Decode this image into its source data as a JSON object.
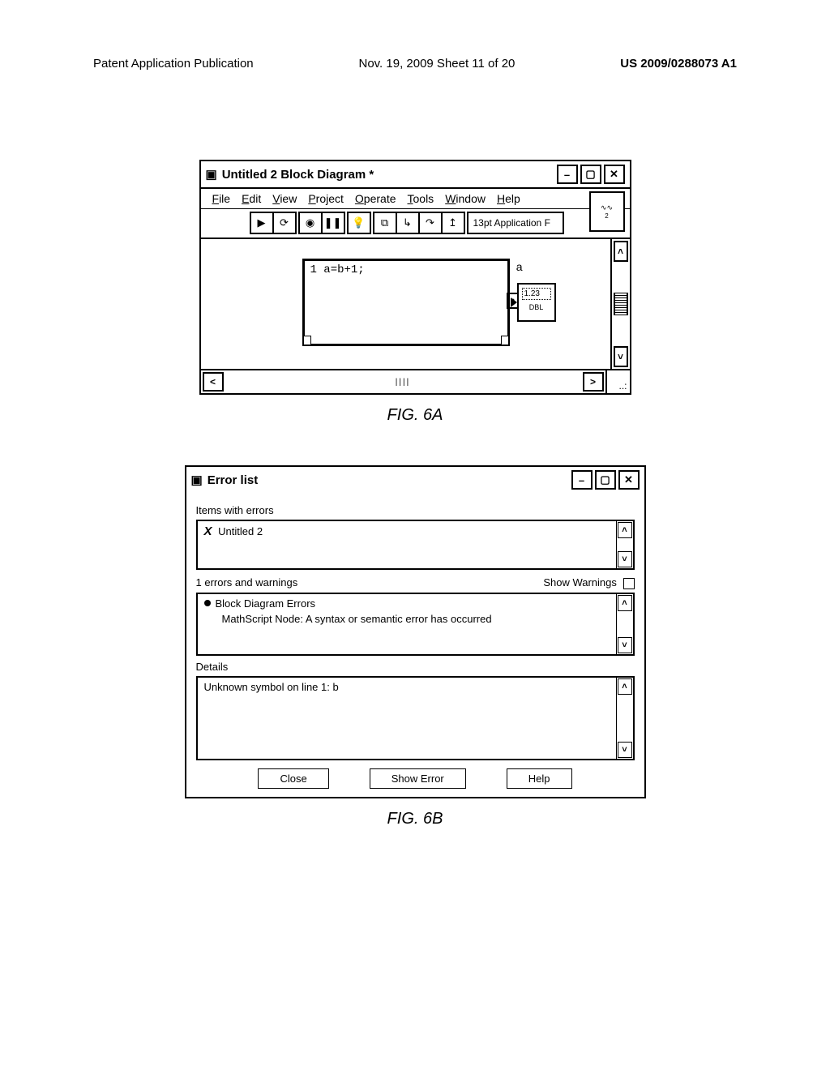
{
  "header": {
    "left": "Patent Application Publication",
    "center": "Nov. 19, 2009  Sheet 11 of 20",
    "right": "US 2009/0288073 A1"
  },
  "windowA": {
    "title": "Untitled 2 Block Diagram *",
    "menus": {
      "file": "File",
      "edit": "Edit",
      "view": "View",
      "project": "Project",
      "operate": "Operate",
      "tools": "Tools",
      "window": "Window",
      "help": "Help"
    },
    "fontbox": "13pt Application F",
    "script_code": "1 a=b+1;",
    "out_label": "a",
    "out_port": "a",
    "indicator_value": "1.23",
    "indicator_type": "DBL"
  },
  "fig6a_caption": "FIG. 6A",
  "windowB": {
    "title": "Error list",
    "items_label": "Items with errors",
    "item1": "Untitled 2",
    "count_label": "1 errors and warnings",
    "show_warnings": "Show Warnings",
    "group_header": "Block Diagram Errors",
    "error_line": "MathScript Node: A syntax or semantic error has occurred",
    "details_label": "Details",
    "details_text": "Unknown symbol on line 1: b",
    "btn_close": "Close",
    "btn_show": "Show Error",
    "btn_help": "Help"
  },
  "fig6b_caption": "FIG. 6B"
}
